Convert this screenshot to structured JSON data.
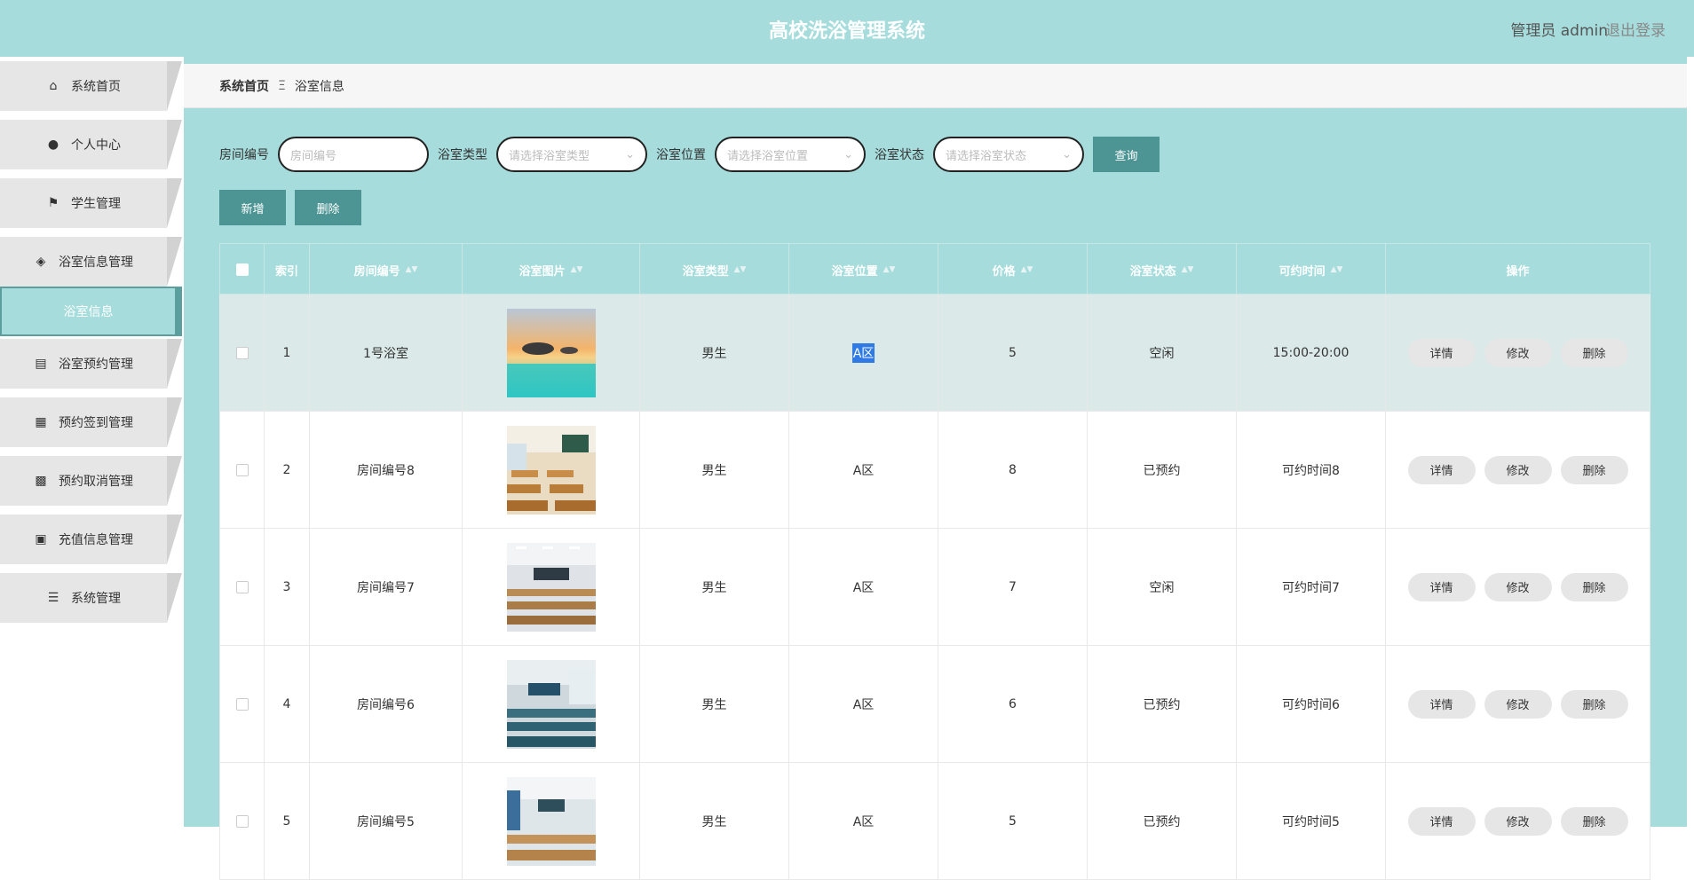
{
  "header": {
    "title": "高校洗浴管理系统",
    "user": "管理员 admin",
    "logout": "退出登录"
  },
  "sidebar": {
    "items": [
      {
        "label": "系统首页",
        "icon": "home-icon"
      },
      {
        "label": "个人中心",
        "icon": "person-icon"
      },
      {
        "label": "学生管理",
        "icon": "flag-icon"
      },
      {
        "label": "浴室信息管理",
        "icon": "bulb-icon"
      },
      {
        "label": "浴室预约管理",
        "icon": "chart-icon"
      },
      {
        "label": "预约签到管理",
        "icon": "grid-icon"
      },
      {
        "label": "预约取消管理",
        "icon": "chat-icon"
      },
      {
        "label": "充值信息管理",
        "icon": "dashboard-icon"
      },
      {
        "label": "系统管理",
        "icon": "list-icon"
      }
    ],
    "active_sub": "浴室信息"
  },
  "breadcrumb": {
    "home": "系统首页",
    "sep": "Ξ",
    "current": "浴室信息"
  },
  "search": {
    "room_no_label": "房间编号",
    "room_no_placeholder": "房间编号",
    "type_label": "浴室类型",
    "type_placeholder": "请选择浴室类型",
    "location_label": "浴室位置",
    "location_placeholder": "请选择浴室位置",
    "status_label": "浴室状态",
    "status_placeholder": "请选择浴室状态",
    "query_btn": "查询"
  },
  "actions": {
    "add": "新增",
    "delete": "删除"
  },
  "table": {
    "columns": [
      "索引",
      "房间编号",
      "浴室图片",
      "浴室类型",
      "浴室位置",
      "价格",
      "浴室状态",
      "可约时间",
      "操作"
    ],
    "rows": [
      {
        "index": "1",
        "room_no": "1号浴室",
        "type": "男生",
        "location": "A区",
        "price": "5",
        "status": "空闲",
        "time": "15:00-20:00"
      },
      {
        "index": "2",
        "room_no": "房间编号8",
        "type": "男生",
        "location": "A区",
        "price": "8",
        "status": "已预约",
        "time": "可约时间8"
      },
      {
        "index": "3",
        "room_no": "房间编号7",
        "type": "男生",
        "location": "A区",
        "price": "7",
        "status": "空闲",
        "time": "可约时间7"
      },
      {
        "index": "4",
        "room_no": "房间编号6",
        "type": "男生",
        "location": "A区",
        "price": "6",
        "status": "已预约",
        "time": "可约时间6"
      },
      {
        "index": "5",
        "room_no": "房间编号5",
        "type": "男生",
        "location": "A区",
        "price": "5",
        "status": "已预约",
        "time": "可约时间5"
      }
    ],
    "op_buttons": {
      "detail": "详情",
      "edit": "修改",
      "delete": "删除"
    }
  },
  "colors": {
    "primary": "#a6dcdc",
    "button": "#4d9494",
    "menu_bg": "#e6e6e6"
  }
}
